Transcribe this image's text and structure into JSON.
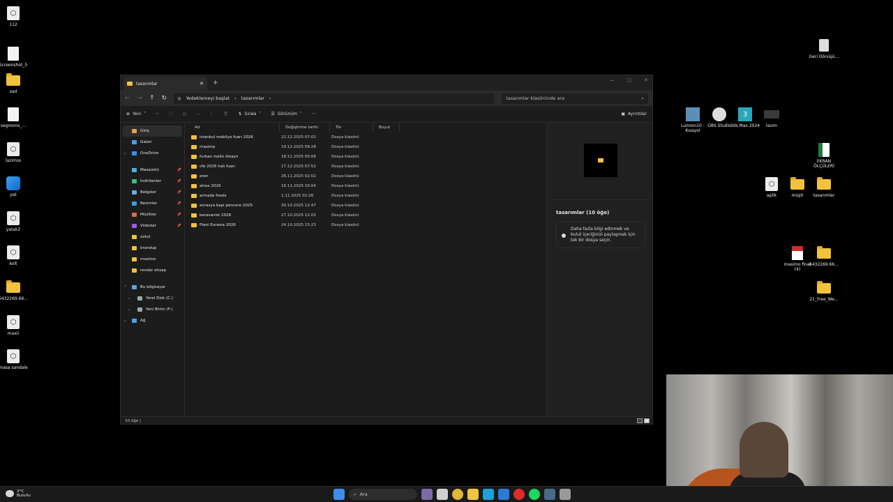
{
  "desktop_left": [
    {
      "label": "112",
      "kind": "gen"
    },
    {
      "label": "Screenshot_5",
      "kind": "file"
    },
    {
      "label": "sad",
      "kind": "folder"
    },
    {
      "label": "segmono_...",
      "kind": "file"
    },
    {
      "label": "lazimss",
      "kind": "gen"
    },
    {
      "label": "yat",
      "kind": "blue"
    },
    {
      "label": "yatak2",
      "kind": "gen"
    },
    {
      "label": "kolt",
      "kind": "gen"
    },
    {
      "label": "6432269.66...",
      "kind": "folder"
    },
    {
      "label": "maxii",
      "kind": "gen"
    },
    {
      "label": "masa sandale",
      "kind": "gen"
    }
  ],
  "desktop_right": {
    "recycle": "Geri Dönüşü...",
    "apps": [
      "Lumion10 - Kısayol",
      "OBS Studio",
      "3ds Max 2024",
      "lazım"
    ],
    "excel": "EKRAN ÖLÇÜLERİ",
    "row2": [
      "aplik",
      "müşti",
      "tasarımlar"
    ],
    "pdf": "masimo final (4)",
    "folder1": "6432269.66...",
    "folder2": "21_Free_We..."
  },
  "explorer": {
    "tab_title": "tasarımlar",
    "address": {
      "segment1": "Yedeklemeyi başlat",
      "segment2": "tasarımlar"
    },
    "search_placeholder": "tasarımlar klasöründe ara",
    "commands": {
      "new": "Yeni",
      "sort": "Sırala",
      "view": "Görünüm",
      "more": "···",
      "details": "Ayrıntılar"
    },
    "sidebar": [
      {
        "label": "Giriş",
        "color": "#e5a24a",
        "selected": true
      },
      {
        "label": "Galeri",
        "color": "#4a9fe5"
      },
      {
        "label": "OneDrive",
        "color": "#3a8ee8",
        "chev": true
      },
      {
        "gap": true
      },
      {
        "label": "Masaüstü",
        "color": "#4fb0e0",
        "pin": true
      },
      {
        "label": "İndirilenler",
        "color": "#3fc07a",
        "pin": true
      },
      {
        "label": "Belgeler",
        "color": "#6aa8e8",
        "pin": true
      },
      {
        "label": "Resimler",
        "color": "#3f9ae0",
        "pin": true
      },
      {
        "label": "Müzikler",
        "color": "#e06a4a",
        "pin": true
      },
      {
        "label": "Videolar",
        "color": "#a05ae0",
        "pin": true
      },
      {
        "label": "ozkul",
        "color": "#f2c23c"
      },
      {
        "label": "brandup",
        "color": "#f2c23c"
      },
      {
        "label": "masimo",
        "color": "#f2c23c"
      },
      {
        "label": "render ehsap",
        "color": "#f2c23c"
      },
      {
        "gap": true
      },
      {
        "label": "Bu bilgisayar",
        "color": "#5aa6e8",
        "chev": true,
        "open": true
      },
      {
        "label": "Yerel Disk (C:)",
        "color": "#9aa",
        "chev": true,
        "indent": true
      },
      {
        "label": "Yeni Birim (F:)",
        "color": "#9aa",
        "chev": true,
        "indent": true
      },
      {
        "label": "Ağ",
        "color": "#4fa0e8",
        "chev": true
      }
    ],
    "columns": [
      "Ad",
      "Değiştirme tarihi",
      "Tür",
      "Boyut"
    ],
    "files": [
      {
        "name": "istanbul mobilya fuarı 2026",
        "date": "22.12.2025 07:02",
        "type": "Dosya klasörü"
      },
      {
        "name": "masima",
        "date": "19.12.2025 09:28",
        "type": "Dosya klasörü"
      },
      {
        "name": "furkan melin dizayn",
        "date": "18.12.2025 05:06",
        "type": "Dosya klasörü"
      },
      {
        "name": "cfe 2026 halı fuarı",
        "date": "17.12.2025 07:52",
        "type": "Dosya klasörü"
      },
      {
        "name": "eren",
        "date": "28.11.2025 02:02",
        "type": "Dosya klasörü"
      },
      {
        "name": "atrax 2026",
        "date": "16.11.2025 16:04",
        "type": "Dosya klasörü"
      },
      {
        "name": "armada foods",
        "date": "1.11.2025 02:26",
        "type": "Dosya klasörü"
      },
      {
        "name": "avrasya kapı pencere 2025",
        "date": "30.10.2025 12:47",
        "type": "Dosya klasörü"
      },
      {
        "name": "karavanist 2026",
        "date": "27.10.2025 12:02",
        "type": "Dosya klasörü"
      },
      {
        "name": "Plast Eurasia 2026",
        "date": "24.10.2025 15:23",
        "type": "Dosya klasörü"
      }
    ],
    "preview_title": "tasarımlar (10 öğe)",
    "preview_hint": "Daha fazla bilgi edinmek ve bulut içeriğinizi paylaşmak için tek bir dosya seçin.",
    "status": "10 öğe  |"
  },
  "taskbar": {
    "weather": "3°C",
    "weather_desc": "Bulutlu",
    "search": "Ara",
    "icons": [
      {
        "name": "start-icon",
        "color": "#3d8ee8"
      },
      {
        "name": "search",
        "color": ""
      },
      {
        "name": "widget-icon",
        "color": "#7a6aa8"
      },
      {
        "name": "task-view-icon",
        "color": "#cfcfcf"
      },
      {
        "name": "chrome-icon",
        "color": "#e0b53a"
      },
      {
        "name": "file-explorer-icon",
        "color": "#f2c23c"
      },
      {
        "name": "edge-icon",
        "color": "#1ea0d8"
      },
      {
        "name": "outlook-icon",
        "color": "#2b7ad6"
      },
      {
        "name": "opera-icon",
        "color": "#e02b2b"
      },
      {
        "name": "spotify-icon",
        "color": "#1ed760"
      },
      {
        "name": "steam-icon",
        "color": "#4a6a8a"
      },
      {
        "name": "settings-icon",
        "color": "#9a9a9a"
      }
    ]
  }
}
